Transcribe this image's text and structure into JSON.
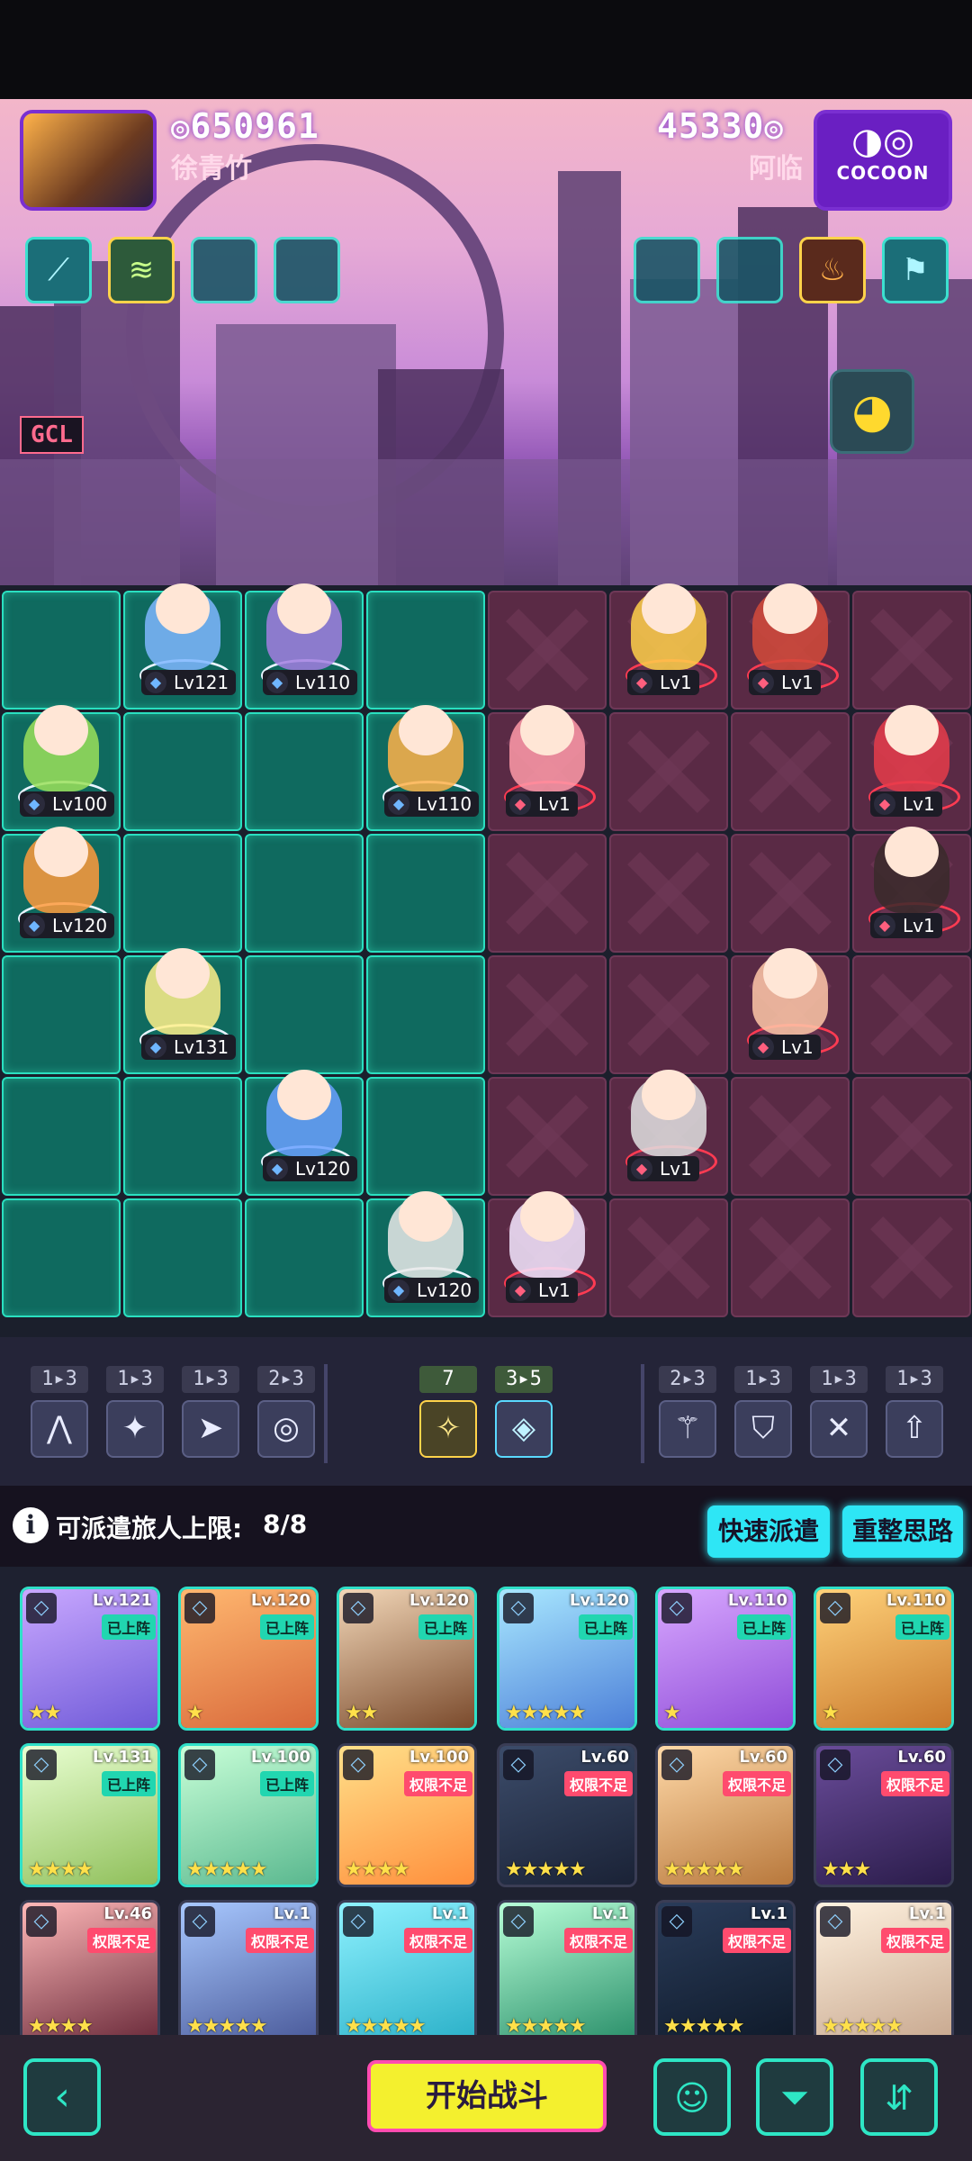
{
  "player_left": {
    "score": "650961",
    "name": "徐青竹"
  },
  "player_right": {
    "score": "45330",
    "name": "阿临",
    "badge": "COCOON"
  },
  "scene": {
    "sign_gcl": "GCL"
  },
  "board": {
    "ally_units": [
      {
        "level": "Lv121"
      },
      {
        "level": "Lv110"
      },
      {
        "level": "Lv100"
      },
      {
        "level": "Lv110"
      },
      {
        "level": "Lv120"
      },
      {
        "level": "Lv131"
      },
      {
        "level": "Lv120"
      },
      {
        "level": "Lv120"
      }
    ],
    "enemy_units": [
      {
        "level": "Lv1"
      },
      {
        "level": "Lv1"
      },
      {
        "level": "Lv1"
      },
      {
        "level": "Lv1"
      },
      {
        "level": "Lv1"
      },
      {
        "level": "Lv1"
      },
      {
        "level": "Lv1"
      },
      {
        "level": "Lv1"
      }
    ]
  },
  "traits": {
    "left": [
      {
        "count": "1▸3",
        "icon": "peaks-icon"
      },
      {
        "count": "1▸3",
        "icon": "shuriken-icon"
      },
      {
        "count": "1▸3",
        "icon": "arrowhead-icon"
      },
      {
        "count": "2▸3",
        "icon": "swirl-icon"
      }
    ],
    "center": [
      {
        "count": "7",
        "icon": "sparkle-icon"
      },
      {
        "count": "3▸5",
        "icon": "diamond-icon"
      }
    ],
    "right": [
      {
        "count": "2▸3",
        "icon": "bow-icon"
      },
      {
        "count": "1▸3",
        "icon": "shield-icon"
      },
      {
        "count": "1▸3",
        "icon": "crossed-swords-icon"
      },
      {
        "count": "1▸3",
        "icon": "up-arrow-icon"
      }
    ]
  },
  "deploy": {
    "label": "可派遣旅人上限:",
    "count": "8/8",
    "quick_button": "快速派遣",
    "reset_button": "重整思路"
  },
  "roster": [
    {
      "level": "Lv.121",
      "status": "已上阵",
      "stars": "★★"
    },
    {
      "level": "Lv.120",
      "status": "已上阵",
      "stars": "★"
    },
    {
      "level": "Lv.120",
      "status": "已上阵",
      "stars": "★★"
    },
    {
      "level": "Lv.120",
      "status": "已上阵",
      "stars": "★★★★★"
    },
    {
      "level": "Lv.110",
      "status": "已上阵",
      "stars": "★"
    },
    {
      "level": "Lv.110",
      "status": "已上阵",
      "stars": "★"
    },
    {
      "level": "Lv.131",
      "status": "已上阵",
      "stars": "★★★★"
    },
    {
      "level": "Lv.100",
      "status": "已上阵",
      "stars": "★★★★★"
    },
    {
      "level": "Lv.100",
      "status": "权限不足",
      "stars": "★★★★"
    },
    {
      "level": "Lv.60",
      "status": "权限不足",
      "stars": "★★★★★"
    },
    {
      "level": "Lv.60",
      "status": "权限不足",
      "stars": "★★★★★"
    },
    {
      "level": "Lv.60",
      "status": "权限不足",
      "stars": "★★★"
    },
    {
      "level": "Lv.46",
      "status": "权限不足",
      "stars": "★★★★"
    },
    {
      "level": "Lv.1",
      "status": "权限不足",
      "stars": "★★★★★"
    },
    {
      "level": "Lv.1",
      "status": "权限不足",
      "stars": "★★★★★"
    },
    {
      "level": "Lv.1",
      "status": "权限不足",
      "stars": "★★★★★"
    },
    {
      "level": "Lv.1",
      "status": "权限不足",
      "stars": "★★★★★"
    },
    {
      "level": "Lv.1",
      "status": "权限不足",
      "stars": "★★★★★"
    }
  ],
  "bottom": {
    "start_button": "开始战斗"
  },
  "colors": {
    "ally": "#0f6a5f",
    "enemy": "#5a2a45",
    "accent": "#2ee6f5",
    "start": "#f4f02e"
  }
}
